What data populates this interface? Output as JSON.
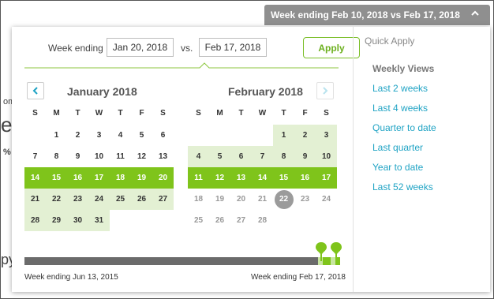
{
  "background": {
    "fragments": [
      "om",
      "e",
      "%",
      "py"
    ]
  },
  "trigger": {
    "label": "Week ending Feb 10, 2018 vs Feb 17, 2018",
    "icon": "chevron-up-icon"
  },
  "header": {
    "week_ending_label": "Week ending",
    "date1": "Jan 20, 2018",
    "vs_label": "vs.",
    "date2": "Feb 17, 2018",
    "apply_label": "Apply"
  },
  "calendars": {
    "dow": [
      "S",
      "M",
      "T",
      "W",
      "T",
      "F",
      "S"
    ],
    "jan": {
      "title": "January 2018",
      "weeks": [
        [
          "",
          "1",
          "2",
          "3",
          "4",
          "5",
          "6"
        ],
        [
          "7",
          "8",
          "9",
          "10",
          "11",
          "12",
          "13"
        ],
        [
          "14",
          "15",
          "16",
          "17",
          "18",
          "19",
          "20"
        ],
        [
          "21",
          "22",
          "23",
          "24",
          "25",
          "26",
          "27"
        ],
        [
          "28",
          "29",
          "30",
          "31",
          "",
          "",
          ""
        ]
      ]
    },
    "feb": {
      "title": "February 2018",
      "weeks": [
        [
          "",
          "",
          "",
          "",
          "1",
          "2",
          "3"
        ],
        [
          "4",
          "5",
          "6",
          "7",
          "8",
          "9",
          "10"
        ],
        [
          "11",
          "12",
          "13",
          "14",
          "15",
          "16",
          "17"
        ],
        [
          "18",
          "19",
          "20",
          "21",
          "22",
          "23",
          "24"
        ],
        [
          "25",
          "26",
          "27",
          "28",
          "",
          "",
          ""
        ]
      ]
    }
  },
  "timeline": {
    "start_label": "Week ending Jun 13, 2015",
    "end_label": "Week ending Feb 17, 2018"
  },
  "sidebar": {
    "title": "Quick Apply",
    "section": "Weekly Views",
    "links": [
      "Last 2 weeks",
      "Last 4 weeks",
      "Quarter to date",
      "Last quarter",
      "Year to date",
      "Last 52 weeks"
    ]
  },
  "colors": {
    "accent_green": "#7fc41b",
    "light_green": "#e3f0d3",
    "link_blue": "#1fa3c4",
    "trigger_gray": "#8f8f8f"
  }
}
